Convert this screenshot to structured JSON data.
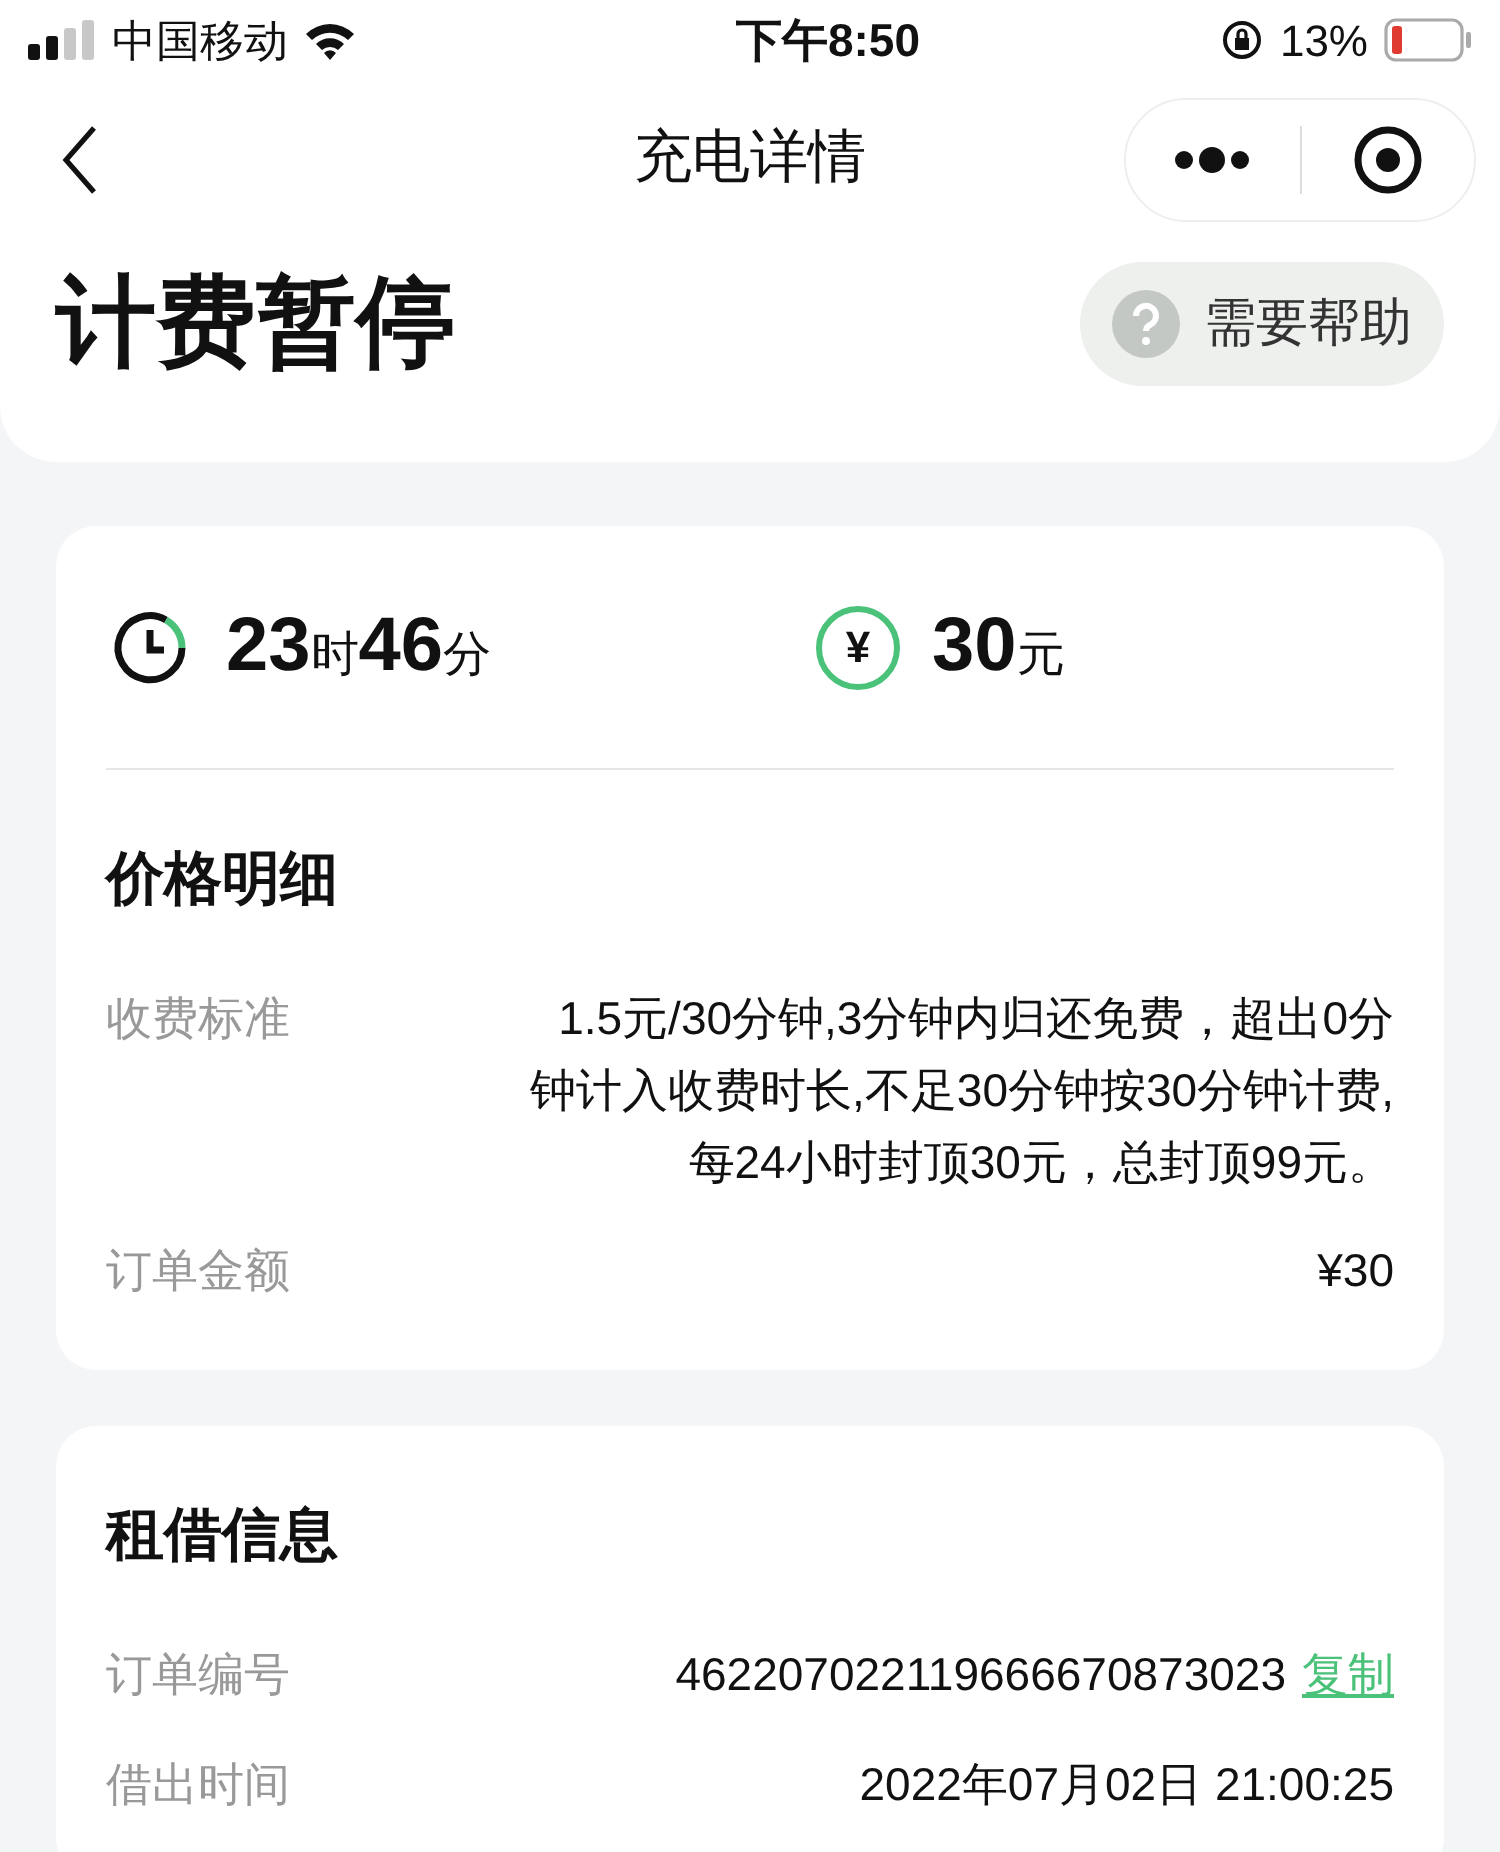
{
  "status_bar": {
    "carrier": "中国移动",
    "time": "下午8:50",
    "battery": "13%"
  },
  "nav": {
    "title": "充电详情"
  },
  "header": {
    "title": "计费暂停",
    "help": "需要帮助"
  },
  "summary": {
    "duration": [
      {
        "value": "23",
        "unit": "时"
      },
      {
        "value": "46",
        "unit": "分"
      }
    ],
    "amount": {
      "value": "30",
      "unit": "元"
    },
    "currency_symbol": "¥"
  },
  "price": {
    "title": "价格明细",
    "rows": [
      {
        "label": "收费标准",
        "lines": [
          "1.5元/30分钟,3分钟内归还免费，超出0分",
          "钟计入收费时长,不足30分钟按30分钟计费,",
          "每24小时封顶30元，总封顶99元。"
        ]
      },
      {
        "label": "订单金额",
        "lines": [
          "¥30"
        ]
      }
    ]
  },
  "rental": {
    "title": "租借信息",
    "rows": [
      {
        "label": "订单编号",
        "value": "462207022119666670873023",
        "link": "复制"
      },
      {
        "label": "借出时间",
        "value": "2022年07月02日 21:00:25"
      }
    ]
  }
}
